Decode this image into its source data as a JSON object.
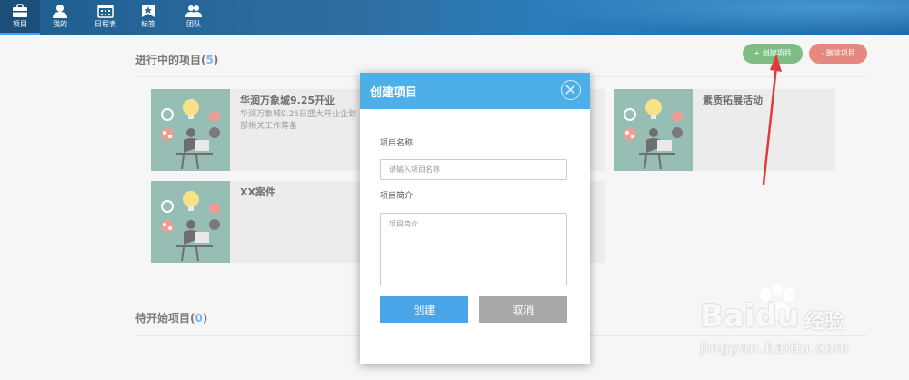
{
  "nav": {
    "items": [
      {
        "label": "项目",
        "icon": "briefcase-icon",
        "active": true
      },
      {
        "label": "我的",
        "icon": "user-icon",
        "active": false
      },
      {
        "label": "日程表",
        "icon": "calendar-icon",
        "active": false
      },
      {
        "label": "标签",
        "icon": "tag-icon",
        "active": false
      },
      {
        "label": "团队",
        "icon": "team-icon",
        "active": false
      }
    ]
  },
  "in_progress": {
    "title": "进行中的项目(",
    "count": "5",
    "close_paren": ")",
    "create_label": "+ 创建项目",
    "delete_label": "- 删除项目",
    "projects": [
      {
        "name": "华润万象城9.25开业",
        "desc": "华润万象城9.25日盛大开业企划部相关工作筹备"
      },
      {
        "name": "素质拓展活动",
        "desc": ""
      },
      {
        "name": "XX案件",
        "desc": ""
      }
    ]
  },
  "pending": {
    "title": "待开始项目(",
    "count": "0",
    "close_paren": ")"
  },
  "modal": {
    "title": "创建项目",
    "name_label": "项目名称",
    "name_placeholder": "请输入项目名称",
    "intro_label": "项目简介",
    "intro_placeholder": "项目简介",
    "ok_label": "创建",
    "cancel_label": "取消"
  },
  "watermark": {
    "brand": "Baidu",
    "jingyan": "经验",
    "url": "jingyan.baidu.com"
  },
  "colors": {
    "accent": "#4daee8",
    "create_green": "#3a9b44",
    "delete_red": "#d8493b",
    "nav_blue": "#2e6fa3"
  }
}
